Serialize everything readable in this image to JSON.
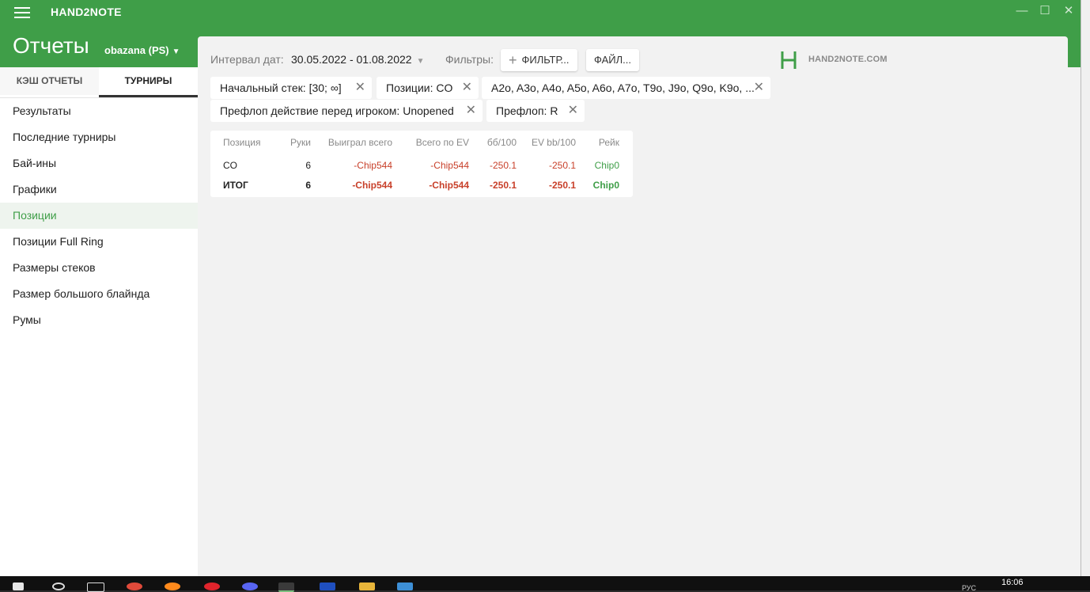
{
  "app": {
    "name": "HAND2NOTE",
    "title": "Отчеты",
    "account": "obazana (PS)"
  },
  "sidebar": {
    "tabs": [
      {
        "label": "КЭШ ОТЧЕТЫ",
        "active": false
      },
      {
        "label": "ТУРНИРЫ",
        "active": true
      }
    ],
    "items": [
      {
        "label": "Результаты"
      },
      {
        "label": "Последние турниры"
      },
      {
        "label": "Бай-ины"
      },
      {
        "label": "Графики"
      },
      {
        "label": "Позиции",
        "active": true
      },
      {
        "label": "Позиции Full Ring"
      },
      {
        "label": "Размеры стеков"
      },
      {
        "label": "Размер большого блайнда"
      },
      {
        "label": "Румы"
      }
    ]
  },
  "toolbar": {
    "date_label": "Интервал дат:",
    "date_value": "30.05.2022 - 01.08.2022",
    "filters_label": "Фильтры:",
    "add_filter_label": "ФИЛЬТР...",
    "file_label": "ФАЙЛ...",
    "logo_text": "HAND2NOTE.COM"
  },
  "filters": [
    "Начальный стек: [30; ∞]",
    "Позиции: CO",
    "A2o, A3o, A4o, A5o, A6o, A7o, T9o, J9o, Q9o, K9o, ...",
    "Префлоп действие перед игроком: Unopened",
    "Префлоп: R"
  ],
  "table": {
    "headers": [
      "Позиция",
      "Руки",
      "Выиграл всего",
      "Всего по EV",
      "бб/100",
      "EV bb/100",
      "Рейк"
    ],
    "rows": [
      {
        "position": "CO",
        "hands": "6",
        "won": "-Chip544",
        "ev_total": "-Chip544",
        "bb100": "-250.1",
        "ev_bb100": "-250.1",
        "rake": "Chip0"
      },
      {
        "position": "ИТОГ",
        "hands": "6",
        "won": "-Chip544",
        "ev_total": "-Chip544",
        "bb100": "-250.1",
        "ev_bb100": "-250.1",
        "rake": "Chip0"
      }
    ]
  },
  "colors": {
    "brand_green": "#3f9e48",
    "negative": "#c8402a"
  },
  "taskbar": {
    "language": "РУС",
    "time": "16:06"
  }
}
